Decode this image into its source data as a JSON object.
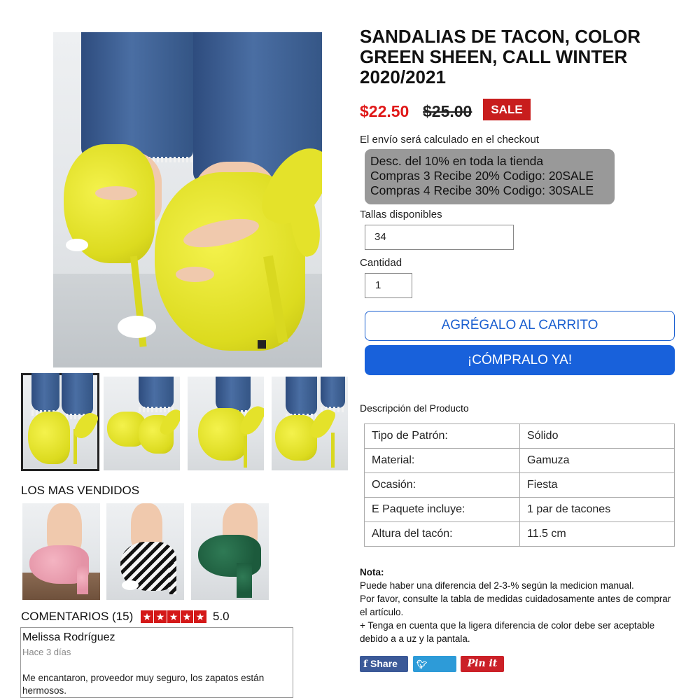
{
  "product": {
    "title": "SANDALIAS DE TACON, COLOR GREEN SHEEN, CALL WINTER 2020/2021",
    "price": "$22.50",
    "old_price": "$25.00",
    "sale_badge": "SALE",
    "shipping_note": "El envío será calculado en el checkout",
    "promo_lines": [
      "Desc. del 10% en toda la tienda",
      "Compras 3 Recibe 20% Codigo: 20SALE",
      "Compras 4 Recibe 30% Codigo: 30SALE"
    ],
    "sizes_label": "Tallas disponibles",
    "size_value": "34",
    "qty_label": "Cantidad",
    "qty_value": "1",
    "add_to_cart": "AGRÉGALO AL CARRITO",
    "buy_now": "¡CÓMPRALO YA!",
    "main_image_icon": "yellow-heel-sandal-photo",
    "thumbnails": [
      "yellow-heel-view-1",
      "yellow-heel-view-2",
      "yellow-heel-view-3",
      "yellow-heel-view-4"
    ],
    "selected_thumbnail": 0
  },
  "description": {
    "heading": "Descripción del Producto",
    "specs": [
      {
        "key": "Tipo de Patrón:",
        "value": "Sólido"
      },
      {
        "key": "Material:",
        "value": "Gamuza"
      },
      {
        "key": "Ocasión:",
        "value": "Fiesta"
      },
      {
        "key": "E Paquete incluye:",
        "value": "1 par de tacones"
      },
      {
        "key": "Altura del tacón:",
        "value": "11.5 cm"
      }
    ],
    "note_title": "Nota",
    "note_lines": [
      "Puede haber una diferencia del 2-3-% según la medicion manual.",
      "Por favor, consulte la tabla de medidas cuidadosamente antes de comprar el artículo.",
      "+ Tenga en cuenta que la ligera diferencia de color debe ser aceptable debido a a uz y la pantala."
    ]
  },
  "share": {
    "facebook": "Share",
    "twitter": "Tweet",
    "pinterest": "Pin it"
  },
  "best_sellers": {
    "heading": "LOS MAS VENDIDOS",
    "items": [
      "pink-lace-up-heel",
      "striped-lace-up-heel",
      "green-strappy-heel"
    ]
  },
  "reviews": {
    "heading": "COMENTARIOS (15)",
    "rating": "5.0",
    "stars": 5,
    "items": [
      {
        "author": "Melissa Rodríguez",
        "date": "Hace 3 días",
        "text": "Me encantaron, proveedor muy seguro, los zapatos están hermosos."
      }
    ]
  },
  "colors": {
    "price_red": "#e01818",
    "sale_bg": "#c81d1d",
    "cta_blue": "#1861db",
    "promo_gray": "#999999",
    "star_red": "#d41818",
    "facebook": "#3b5998",
    "twitter": "#2d9bd8",
    "pinterest": "#cb2027"
  }
}
